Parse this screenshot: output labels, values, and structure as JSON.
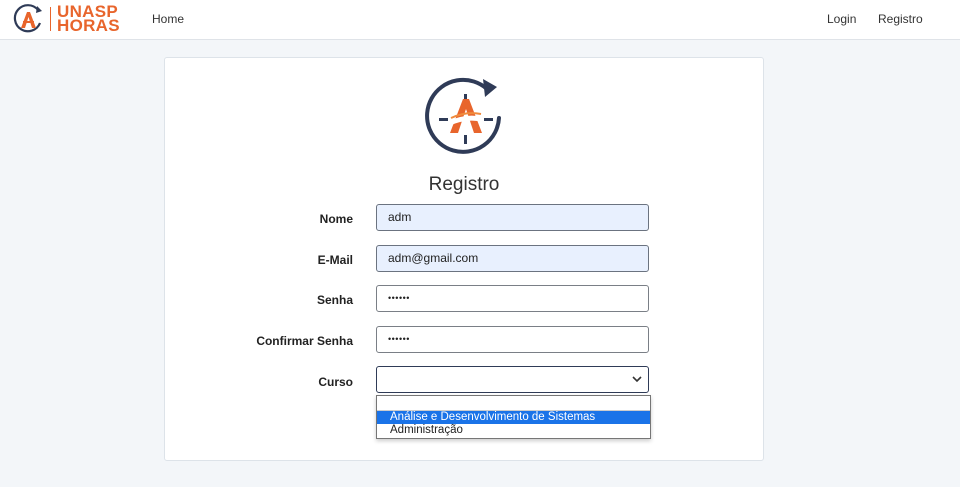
{
  "brand": {
    "line1": "UNASP",
    "line2": "HORAS",
    "accent": "#e8652c",
    "navy": "#2f3b57"
  },
  "nav": {
    "home": "Home",
    "login": "Login",
    "registro": "Registro"
  },
  "form": {
    "title": "Registro",
    "fields": [
      {
        "label": "Nome",
        "value": "adm"
      },
      {
        "label": "E-Mail",
        "value": "adm@gmail.com"
      },
      {
        "label": "Senha",
        "value": "••••••"
      },
      {
        "label": "Confirmar Senha",
        "value": "••••••"
      },
      {
        "label": "Curso",
        "value": ""
      }
    ],
    "curso_options": [
      "Análise e Desenvolvimento de Sistemas",
      "Administração"
    ]
  }
}
